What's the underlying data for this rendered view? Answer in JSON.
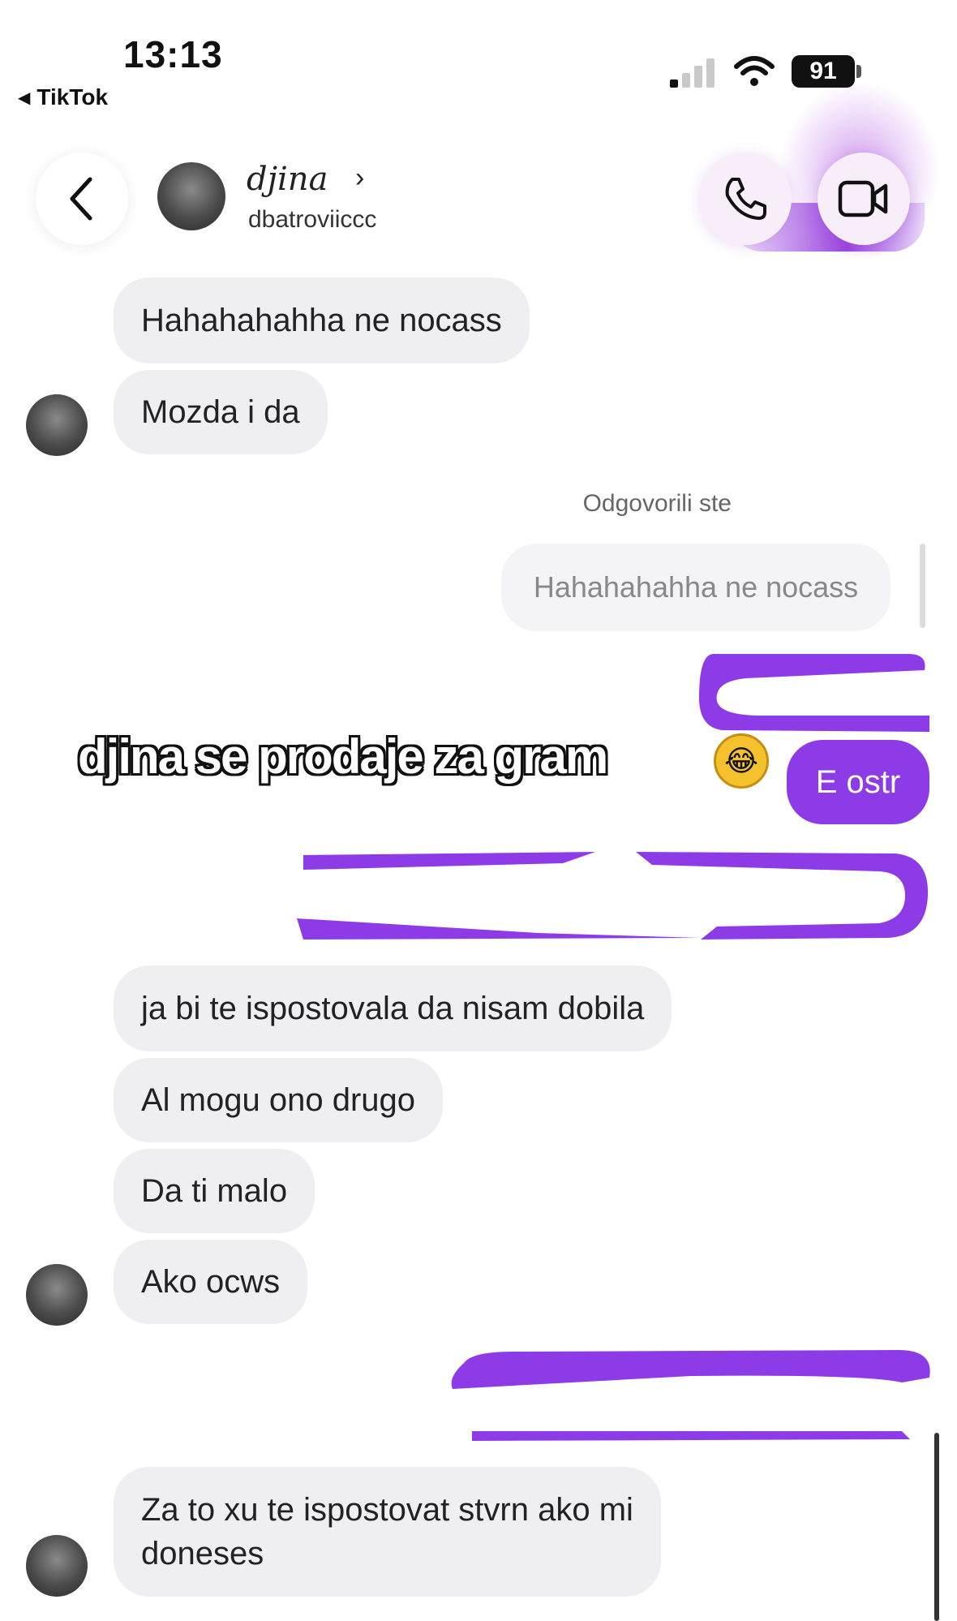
{
  "status_bar": {
    "time": "13:13",
    "back_app": "TikTok",
    "battery": "91"
  },
  "header": {
    "name": "djina",
    "handle": "dbatroviiccc",
    "icons": [
      "back-arrow-icon",
      "phone-icon",
      "video-camera-icon"
    ]
  },
  "messages": {
    "in1": "Hahahahahha ne nocass",
    "in2": "Mozda i da",
    "reply_label": "Odgovorili ste",
    "reply_quote": "Hahahahahha ne nocass",
    "out1": "E ostr",
    "in3": "ja bi te ispostovala da nisam dobila",
    "in4": "Al mogu ono drugo",
    "in5": "Da ti malo",
    "in6": "Ako ocws",
    "in7_line1": "Za to xu te ispostovat stvrn ako mi",
    "in7_line2": "doneses"
  },
  "overlay": {
    "caption": "djina se prodaje za gram",
    "emoji": "😂"
  },
  "colors": {
    "accent": "#8c3be7",
    "incoming_bubble": "#efeff2"
  }
}
